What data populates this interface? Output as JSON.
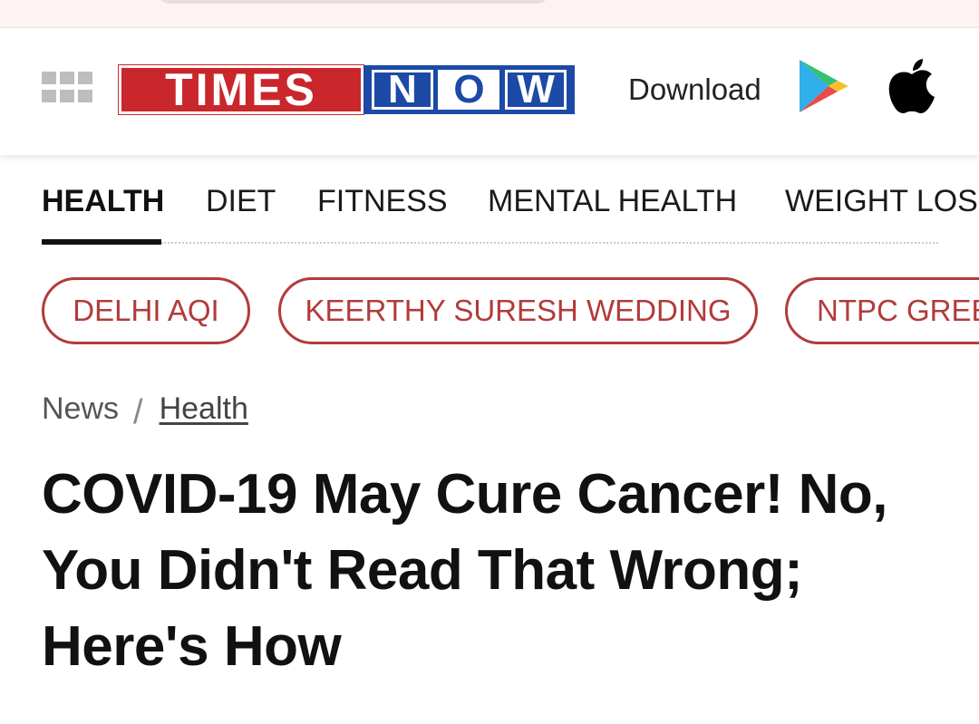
{
  "header": {
    "logo_left": "TIMES",
    "logo_right": [
      "N",
      "O",
      "W"
    ],
    "download_label": "Download"
  },
  "colors": {
    "brand_red": "#c9272b",
    "brand_blue": "#1c4aa6",
    "pill_accent": "#b23b3b"
  },
  "tabs": [
    {
      "label": "HEALTH",
      "active": true
    },
    {
      "label": "DIET",
      "active": false
    },
    {
      "label": "FITNESS",
      "active": false
    },
    {
      "label": "MENTAL HEALTH",
      "active": false
    },
    {
      "label": "WEIGHT LOSS",
      "active": false
    }
  ],
  "trending": [
    {
      "label": "DELHI AQI"
    },
    {
      "label": "KEERTHY SURESH WEDDING"
    },
    {
      "label": "NTPC GREEN"
    }
  ],
  "breadcrumb": {
    "root": "News",
    "separator": "/",
    "current": "Health"
  },
  "article": {
    "headline": "COVID-19 May Cure Cancer! No, You Didn't Read That Wrong; Here's How"
  },
  "icons": {
    "menu": "grid-menu-icon",
    "play_store": "google-play-icon",
    "app_store": "apple-icon"
  }
}
